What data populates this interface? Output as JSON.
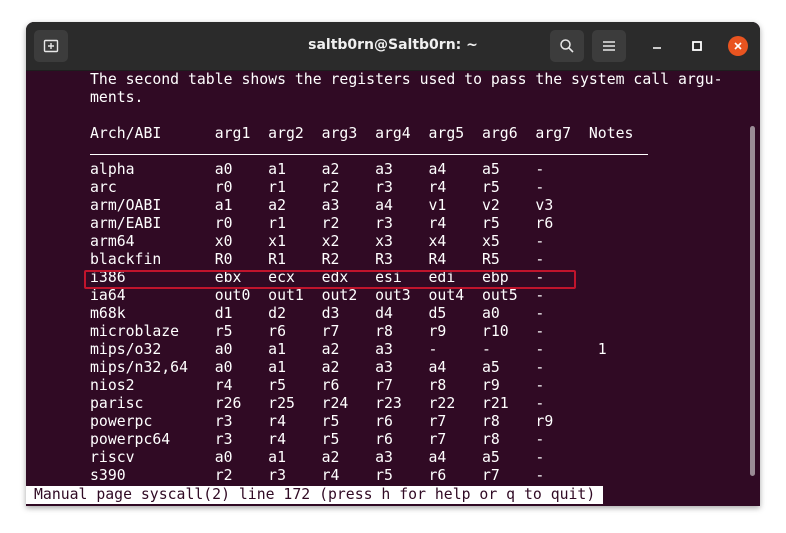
{
  "window": {
    "title": "saltb0rn@Saltb0rn: ~"
  },
  "icons": {
    "new_tab": "new-tab-icon",
    "search": "search-icon",
    "menu": "hamburger-menu-icon",
    "minimize": "minimize-icon",
    "maximize": "maximize-icon",
    "close": "close-icon"
  },
  "colors": {
    "terminal_background": "#300a24",
    "highlight_border": "#c0142c",
    "close_button": "#e95420"
  },
  "terminal": {
    "lines": [
      "The second table shows the registers used to pass the system call argu-",
      "ments.",
      "",
      "Arch/ABI      arg1  arg2  arg3  arg4  arg5  arg6  arg7  Notes",
      "",
      "alpha         a0    a1    a2    a3    a4    a5    -",
      "arc           r0    r1    r2    r3    r4    r5    -",
      "arm/OABI      a1    a2    a3    a4    v1    v2    v3",
      "arm/EABI      r0    r1    r2    r3    r4    r5    r6",
      "arm64         x0    x1    x2    x3    x4    x5    -",
      "blackfin      R0    R1    R2    R3    R4    R5    -",
      "i386          ebx   ecx   edx   esi   edi   ebp   -",
      "ia64          out0  out1  out2  out3  out4  out5  -",
      "m68k          d1    d2    d3    d4    d5    a0    -",
      "microblaze    r5    r6    r7    r8    r9    r10   -",
      "mips/o32      a0    a1    a2    a3    -     -     -      1",
      "mips/n32,64   a0    a1    a2    a3    a4    a5    -",
      "nios2         r4    r5    r6    r7    r8    r9    -",
      "parisc        r26   r25   r24   r23   r22   r21   -",
      "powerpc       r3    r4    r5    r6    r7    r8    r9",
      "powerpc64     r3    r4    r5    r6    r7    r8    -",
      "riscv         a0    a1    a2    a3    a4    a5    -",
      "s390          r2    r3    r4    r5    r6    r7    -"
    ],
    "highlighted_row": "i386",
    "status": "Manual page syscall(2) line 172 (press h for help or q to quit)"
  }
}
